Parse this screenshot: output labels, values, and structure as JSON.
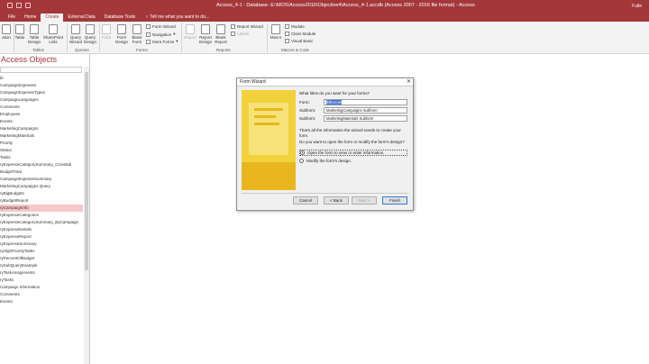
{
  "app": {
    "title": "Access_4-1 : Database- E:\\MOS\\Access2016\\Objective4\\Access_4-1.accdb (Access 2007 - 2016 file format) - Access",
    "user": "Fulle"
  },
  "ribbon_tabs": [
    "File",
    "Home",
    "Create",
    "External Data",
    "Database Tools"
  ],
  "tell_me": "Tell me what you want to do...",
  "ribbon": {
    "buttons": [
      {
        "label": "ation",
        "disabled": false
      },
      {
        "label": "Table",
        "disabled": false
      },
      {
        "label": "Table Design",
        "disabled": false
      },
      {
        "label": "SharePoint Lists",
        "disabled": false
      },
      {
        "label": "Query Wizard",
        "disabled": false
      },
      {
        "label": "Query Design",
        "disabled": false
      },
      {
        "label": "Form",
        "disabled": true
      },
      {
        "label": "Form Design",
        "disabled": false
      },
      {
        "label": "Blank Form",
        "disabled": false
      },
      {
        "label": "Report",
        "disabled": true
      },
      {
        "label": "Report Design",
        "disabled": false
      },
      {
        "label": "Blank Report",
        "disabled": false
      },
      {
        "label": "Macro",
        "disabled": false
      }
    ],
    "small": {
      "form_wizard": "Form Wizard",
      "navigation": "Navigation",
      "more_forms": "More Forms",
      "report_wizard": "Report Wizard",
      "labels": "Labels",
      "module": "Module",
      "class_module": "Class Module",
      "visual_basic": "Visual Basic"
    },
    "groups": [
      "Tables",
      "Queries",
      "Forms",
      "Reports",
      "Macros & Code"
    ]
  },
  "nav": {
    "title": "Access Objects",
    "items": [
      "bl",
      "CampaignExpenses",
      "CampaignExpenseTypes",
      "CampaignLanguages",
      "Comments",
      "Employees",
      "Events",
      "MarketingCampaigns",
      "MarketingMaterials",
      "Priority",
      "Status",
      "Tasks",
      "ryExpenseCategorySummary_Crosstab",
      "BudgetTotal",
      "CampaignExpenseSummary",
      "MarketingCampaigns Query",
      "ryBigBudgets",
      "ryBudgetReport",
      "ryCampaignInfo",
      "ryExpenseCategories",
      "ryExpenseCategorySummary_ByCampaign",
      "ryExpenseDetails",
      "ryExpenseReport",
      "ryExpenseSummary",
      "ryHighPriorityTasks",
      "ryPercentOfBudget",
      "rySubQueryExample",
      "ryTaskAssignments",
      "ryTasks",
      "Campaign Information",
      "Comments",
      "Events"
    ],
    "selected_index": 18
  },
  "dialog": {
    "title": "Form Wizard",
    "close": "✕",
    "question": "What titles do you want for your forms?",
    "fields": [
      {
        "label": "Form:",
        "value": "tblEvents"
      },
      {
        "label": "Subform:",
        "value": "MarketingCampaigns Subform"
      },
      {
        "label": "Subform:",
        "value": "MarketingMaterials Subform"
      }
    ],
    "info": "That's all the information the wizard needs to create your form.",
    "open_question": "Do you want to open the form or modify the form's design?",
    "options": [
      {
        "label": "Open the form to view or enter information.",
        "selected": true
      },
      {
        "label": "Modify the form's design.",
        "selected": false
      }
    ],
    "buttons": {
      "cancel": "Cancel",
      "back": "< Back",
      "next": "Next >",
      "finish": "Finish"
    }
  }
}
